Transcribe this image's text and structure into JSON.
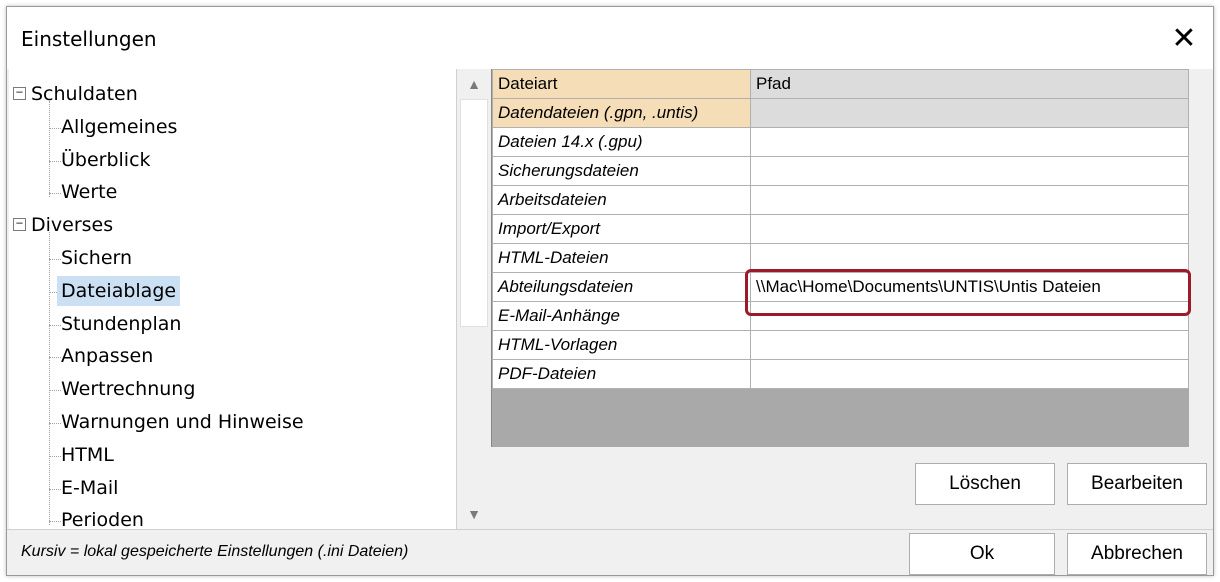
{
  "window": {
    "title": "Einstellungen",
    "close_glyph": "✕"
  },
  "tree": {
    "groups": [
      {
        "label": "Schuldaten",
        "children": [
          "Allgemeines",
          "Überblick",
          "Werte"
        ]
      },
      {
        "label": "Diverses",
        "children": [
          "Sichern",
          "Dateiablage",
          "Stundenplan",
          "Anpassen",
          "Wertrechnung",
          "Warnungen und Hinweise",
          "HTML",
          "E-Mail",
          "Perioden"
        ]
      }
    ],
    "selected": "Dateiablage",
    "expander_glyph": "−"
  },
  "scroll": {
    "up_glyph": "▲",
    "down_glyph": "▼"
  },
  "grid": {
    "headers": [
      "Dateiart",
      "Pfad"
    ],
    "rows": [
      {
        "type": "Datendateien (.gpn, .untis)",
        "path": ""
      },
      {
        "type": "Dateien 14.x (.gpu)",
        "path": ""
      },
      {
        "type": "Sicherungsdateien",
        "path": ""
      },
      {
        "type": "Arbeitsdateien",
        "path": ""
      },
      {
        "type": "Import/Export",
        "path": ""
      },
      {
        "type": "HTML-Dateien",
        "path": ""
      },
      {
        "type": "Abteilungsdateien",
        "path": "\\\\Mac\\Home\\Documents\\UNTIS\\Untis Dateien"
      },
      {
        "type": "E-Mail-Anhänge",
        "path": ""
      },
      {
        "type": "HTML-Vorlagen",
        "path": ""
      },
      {
        "type": "PDF-Dateien",
        "path": ""
      }
    ]
  },
  "buttons": {
    "delete": "Löschen",
    "edit": "Bearbeiten",
    "ok": "Ok",
    "cancel": "Abbrechen"
  },
  "footer": {
    "note": "Kursiv = lokal gespeicherte Einstellungen (.ini Dateien)"
  },
  "colors": {
    "highlight": "#9b1b2a",
    "selection": "#cce0f4",
    "header_accent": "#f5ddb8"
  }
}
